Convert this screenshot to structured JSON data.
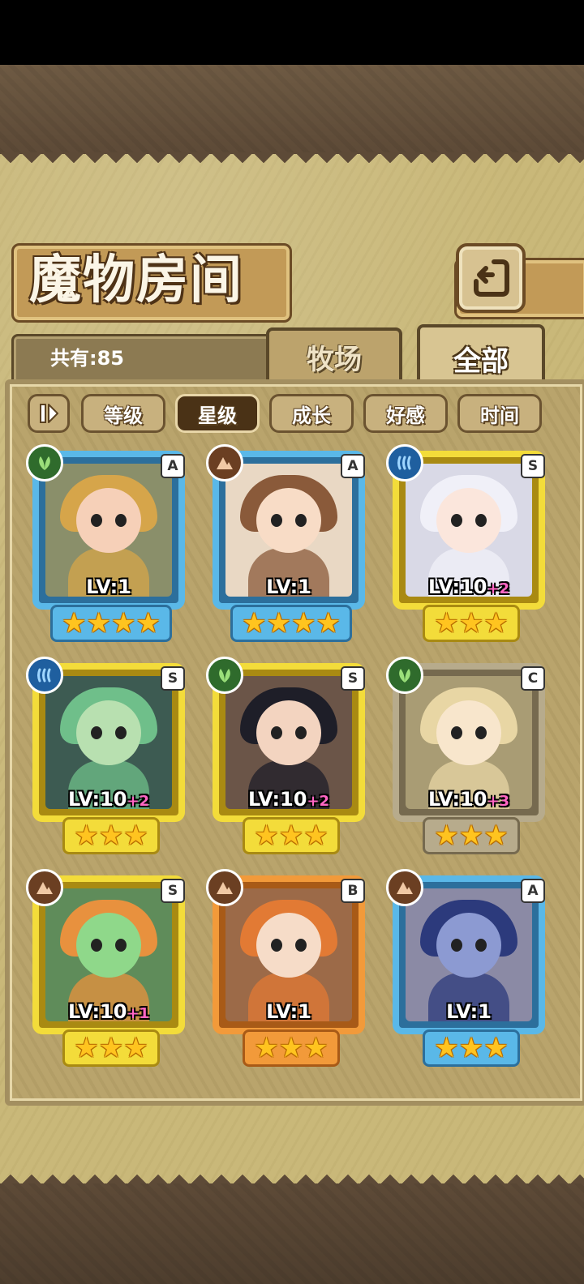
{
  "header": {
    "title": "魔物房间",
    "total_label": "共有:85"
  },
  "tabs": [
    {
      "label": "牧场",
      "active": false
    },
    {
      "label": "全部",
      "active": true
    }
  ],
  "sort_buttons": [
    {
      "label": "等级",
      "active": false
    },
    {
      "label": "星级",
      "active": true
    },
    {
      "label": "成长",
      "active": false
    },
    {
      "label": "好感",
      "active": false
    },
    {
      "label": "时间",
      "active": false
    }
  ],
  "monsters": [
    {
      "level": "LV:1",
      "bonus": "",
      "rank": "A",
      "stars": 4,
      "element": "leaf-icon",
      "frame": "blue"
    },
    {
      "level": "LV:1",
      "bonus": "",
      "rank": "A",
      "stars": 4,
      "element": "mountain-icon",
      "frame": "blue"
    },
    {
      "level": "LV:10",
      "bonus": "+2",
      "rank": "S",
      "stars": 3,
      "element": "water-icon",
      "frame": "yellow"
    },
    {
      "level": "LV:10",
      "bonus": "+2",
      "rank": "S",
      "stars": 3,
      "element": "water-icon",
      "frame": "yellow"
    },
    {
      "level": "LV:10",
      "bonus": "+2",
      "rank": "S",
      "stars": 3,
      "element": "leaf-icon",
      "frame": "yellow"
    },
    {
      "level": "LV:10",
      "bonus": "+3",
      "rank": "C",
      "stars": 3,
      "element": "leaf-icon",
      "frame": "gray"
    },
    {
      "level": "LV:10",
      "bonus": "+1",
      "rank": "S",
      "stars": 3,
      "element": "mountain-icon",
      "frame": "yellow"
    },
    {
      "level": "LV:1",
      "bonus": "",
      "rank": "B",
      "stars": 3,
      "element": "mountain-icon",
      "frame": "orange"
    },
    {
      "level": "LV:1",
      "bonus": "",
      "rank": "A",
      "stars": 3,
      "element": "mountain-icon",
      "frame": "blue"
    }
  ],
  "colors": {
    "frame_blue": "#5ab8e8",
    "frame_yellow": "#f3dc3a",
    "frame_gray": "#b7ab8c",
    "frame_orange": "#f29a3a",
    "element_leaf": "#2f6b2c",
    "element_mountain": "#6b3f22",
    "element_water": "#1f5f9f",
    "star": "#ffc41f",
    "level_bonus": "#ff66c4"
  }
}
